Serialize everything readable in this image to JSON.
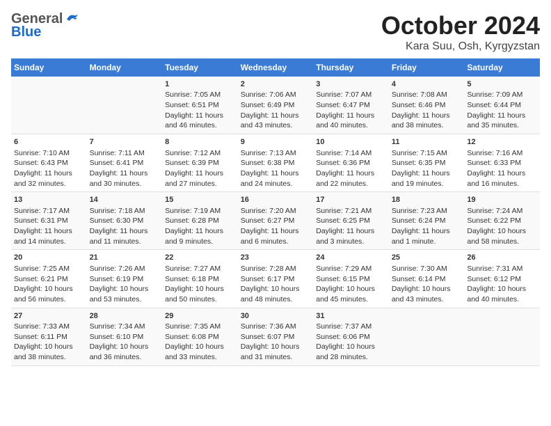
{
  "logo": {
    "line1": "General",
    "line2": "Blue"
  },
  "title": "October 2024",
  "location": "Kara Suu, Osh, Kyrgyzstan",
  "days_of_week": [
    "Sunday",
    "Monday",
    "Tuesday",
    "Wednesday",
    "Thursday",
    "Friday",
    "Saturday"
  ],
  "weeks": [
    [
      {
        "day": "",
        "info": ""
      },
      {
        "day": "",
        "info": ""
      },
      {
        "day": "1",
        "info": "Sunrise: 7:05 AM\nSunset: 6:51 PM\nDaylight: 11 hours and 46 minutes."
      },
      {
        "day": "2",
        "info": "Sunrise: 7:06 AM\nSunset: 6:49 PM\nDaylight: 11 hours and 43 minutes."
      },
      {
        "day": "3",
        "info": "Sunrise: 7:07 AM\nSunset: 6:47 PM\nDaylight: 11 hours and 40 minutes."
      },
      {
        "day": "4",
        "info": "Sunrise: 7:08 AM\nSunset: 6:46 PM\nDaylight: 11 hours and 38 minutes."
      },
      {
        "day": "5",
        "info": "Sunrise: 7:09 AM\nSunset: 6:44 PM\nDaylight: 11 hours and 35 minutes."
      }
    ],
    [
      {
        "day": "6",
        "info": "Sunrise: 7:10 AM\nSunset: 6:43 PM\nDaylight: 11 hours and 32 minutes."
      },
      {
        "day": "7",
        "info": "Sunrise: 7:11 AM\nSunset: 6:41 PM\nDaylight: 11 hours and 30 minutes."
      },
      {
        "day": "8",
        "info": "Sunrise: 7:12 AM\nSunset: 6:39 PM\nDaylight: 11 hours and 27 minutes."
      },
      {
        "day": "9",
        "info": "Sunrise: 7:13 AM\nSunset: 6:38 PM\nDaylight: 11 hours and 24 minutes."
      },
      {
        "day": "10",
        "info": "Sunrise: 7:14 AM\nSunset: 6:36 PM\nDaylight: 11 hours and 22 minutes."
      },
      {
        "day": "11",
        "info": "Sunrise: 7:15 AM\nSunset: 6:35 PM\nDaylight: 11 hours and 19 minutes."
      },
      {
        "day": "12",
        "info": "Sunrise: 7:16 AM\nSunset: 6:33 PM\nDaylight: 11 hours and 16 minutes."
      }
    ],
    [
      {
        "day": "13",
        "info": "Sunrise: 7:17 AM\nSunset: 6:31 PM\nDaylight: 11 hours and 14 minutes."
      },
      {
        "day": "14",
        "info": "Sunrise: 7:18 AM\nSunset: 6:30 PM\nDaylight: 11 hours and 11 minutes."
      },
      {
        "day": "15",
        "info": "Sunrise: 7:19 AM\nSunset: 6:28 PM\nDaylight: 11 hours and 9 minutes."
      },
      {
        "day": "16",
        "info": "Sunrise: 7:20 AM\nSunset: 6:27 PM\nDaylight: 11 hours and 6 minutes."
      },
      {
        "day": "17",
        "info": "Sunrise: 7:21 AM\nSunset: 6:25 PM\nDaylight: 11 hours and 3 minutes."
      },
      {
        "day": "18",
        "info": "Sunrise: 7:23 AM\nSunset: 6:24 PM\nDaylight: 11 hours and 1 minute."
      },
      {
        "day": "19",
        "info": "Sunrise: 7:24 AM\nSunset: 6:22 PM\nDaylight: 10 hours and 58 minutes."
      }
    ],
    [
      {
        "day": "20",
        "info": "Sunrise: 7:25 AM\nSunset: 6:21 PM\nDaylight: 10 hours and 56 minutes."
      },
      {
        "day": "21",
        "info": "Sunrise: 7:26 AM\nSunset: 6:19 PM\nDaylight: 10 hours and 53 minutes."
      },
      {
        "day": "22",
        "info": "Sunrise: 7:27 AM\nSunset: 6:18 PM\nDaylight: 10 hours and 50 minutes."
      },
      {
        "day": "23",
        "info": "Sunrise: 7:28 AM\nSunset: 6:17 PM\nDaylight: 10 hours and 48 minutes."
      },
      {
        "day": "24",
        "info": "Sunrise: 7:29 AM\nSunset: 6:15 PM\nDaylight: 10 hours and 45 minutes."
      },
      {
        "day": "25",
        "info": "Sunrise: 7:30 AM\nSunset: 6:14 PM\nDaylight: 10 hours and 43 minutes."
      },
      {
        "day": "26",
        "info": "Sunrise: 7:31 AM\nSunset: 6:12 PM\nDaylight: 10 hours and 40 minutes."
      }
    ],
    [
      {
        "day": "27",
        "info": "Sunrise: 7:33 AM\nSunset: 6:11 PM\nDaylight: 10 hours and 38 minutes."
      },
      {
        "day": "28",
        "info": "Sunrise: 7:34 AM\nSunset: 6:10 PM\nDaylight: 10 hours and 36 minutes."
      },
      {
        "day": "29",
        "info": "Sunrise: 7:35 AM\nSunset: 6:08 PM\nDaylight: 10 hours and 33 minutes."
      },
      {
        "day": "30",
        "info": "Sunrise: 7:36 AM\nSunset: 6:07 PM\nDaylight: 10 hours and 31 minutes."
      },
      {
        "day": "31",
        "info": "Sunrise: 7:37 AM\nSunset: 6:06 PM\nDaylight: 10 hours and 28 minutes."
      },
      {
        "day": "",
        "info": ""
      },
      {
        "day": "",
        "info": ""
      }
    ]
  ]
}
